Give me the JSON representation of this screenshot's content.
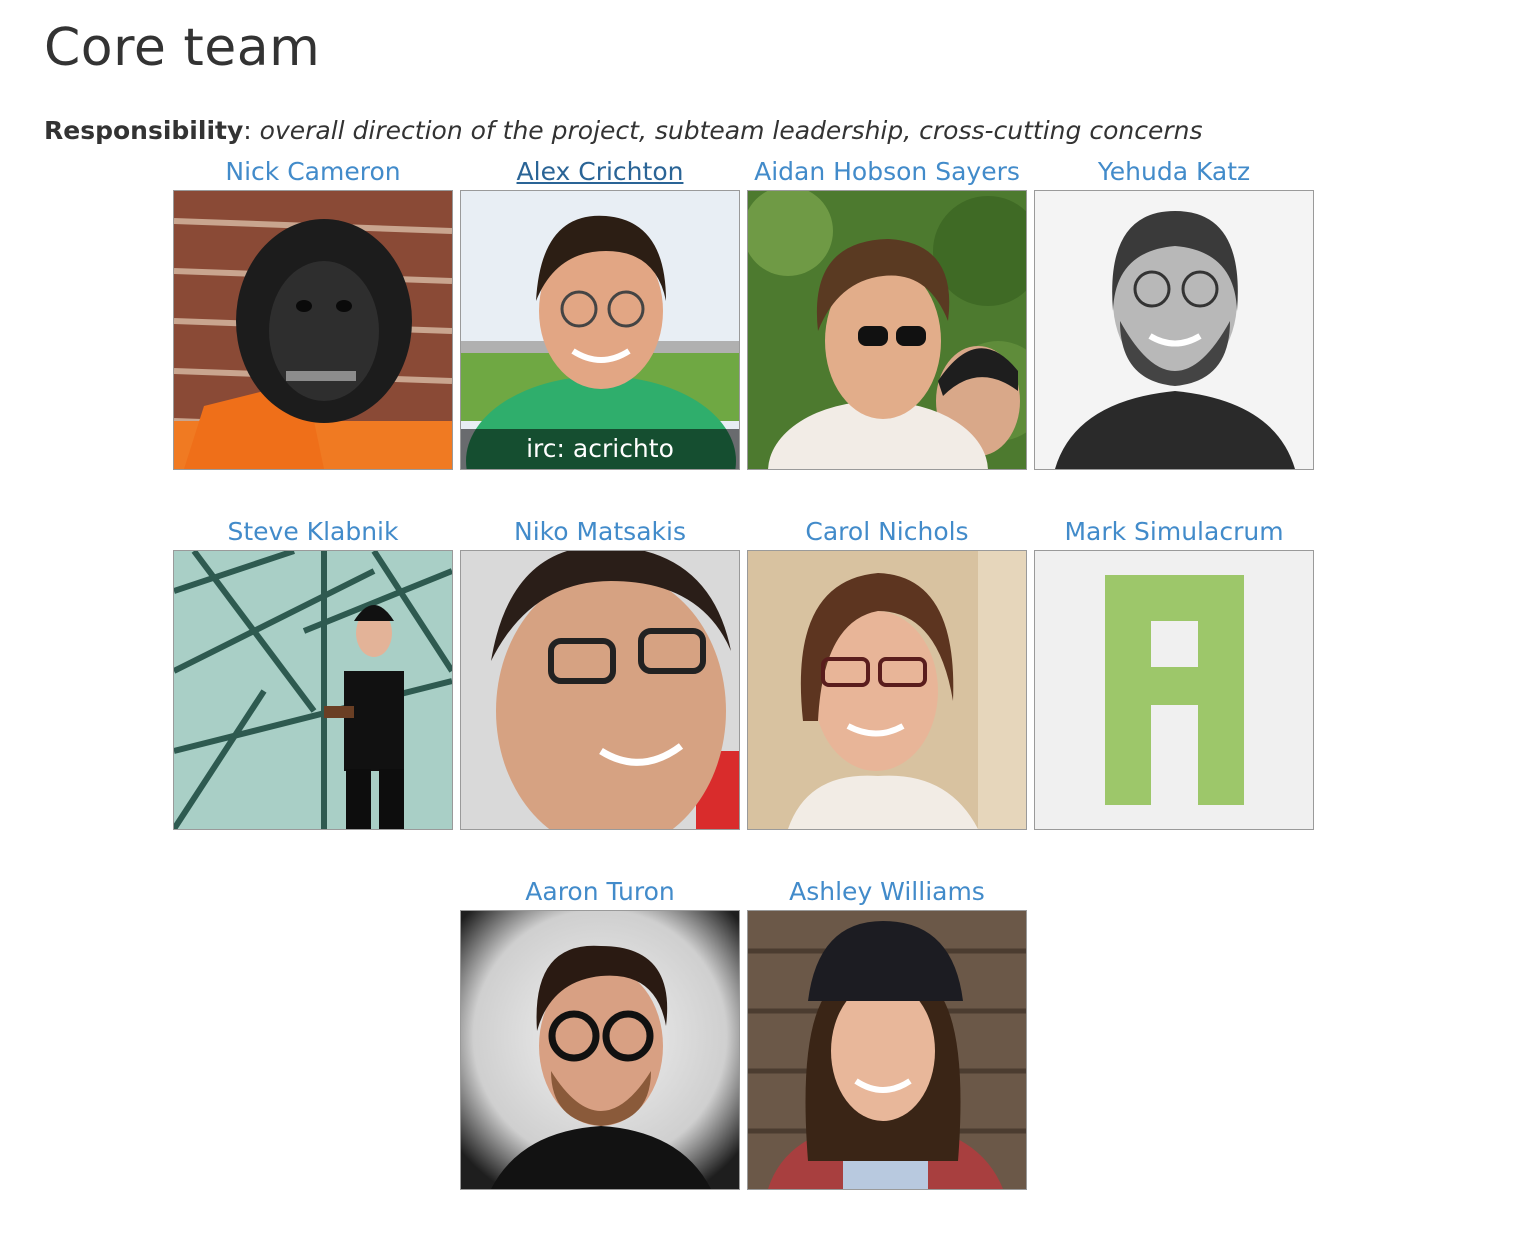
{
  "page": {
    "title": "Core team",
    "responsibility_label": "Responsibility",
    "responsibility_sep": ":",
    "responsibility_text": " overall direction of the project, subteam leadership, cross-cutting concerns"
  },
  "members": [
    {
      "name": "Nick Cameron",
      "photo": "gorilla-mask-avatar"
    },
    {
      "name": "Alex Crichton",
      "photo": "portrait-green-shirt",
      "irc": "irc: acrichto"
    },
    {
      "name": "Aidan Hobson Sayers",
      "photo": "portrait-sunglasses"
    },
    {
      "name": "Yehuda Katz",
      "photo": "portrait-bw"
    },
    {
      "name": "Steve Klabnik",
      "photo": "portrait-glass-dome"
    },
    {
      "name": "Niko Matsakis",
      "photo": "portrait-glasses-closeup"
    },
    {
      "name": "Carol Nichols",
      "photo": "portrait-glasses-woman"
    },
    {
      "name": "Mark Simulacrum",
      "photo": "identicon-green"
    },
    {
      "name": "Aaron Turon",
      "photo": "portrait-vignette"
    },
    {
      "name": "Ashley Williams",
      "photo": "portrait-beanie"
    }
  ],
  "colors": {
    "link": "#428bca",
    "link_hover": "#2a6496",
    "identicon": "#9dc76a",
    "identicon_bg": "#f0f0f0"
  }
}
